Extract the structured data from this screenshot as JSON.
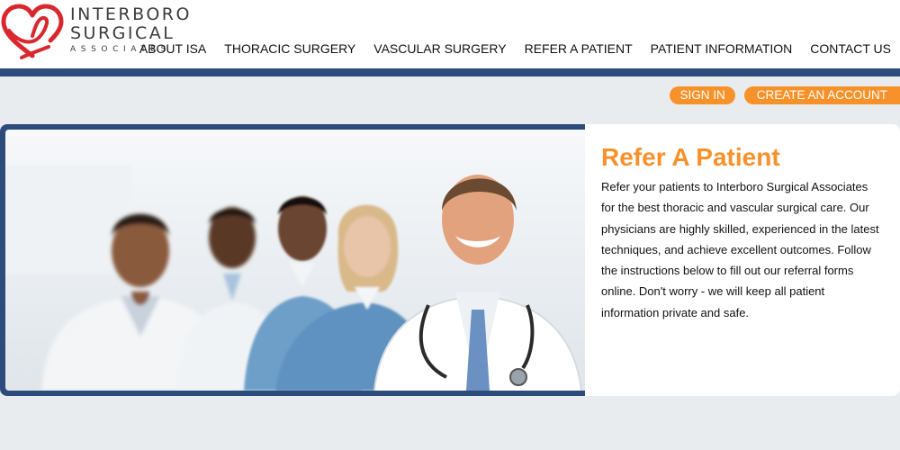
{
  "brand": {
    "line1": "INTERBORO",
    "line2": "SURGICAL",
    "line3": "ASSOCIATES",
    "heart_color": "#d9272e"
  },
  "nav": {
    "items": [
      {
        "label": "ABOUT ISA"
      },
      {
        "label": "THORACIC SURGERY"
      },
      {
        "label": "VASCULAR SURGERY"
      },
      {
        "label": "REFER A PATIENT"
      },
      {
        "label": "PATIENT INFORMATION"
      },
      {
        "label": "CONTACT US"
      }
    ]
  },
  "account": {
    "sign_in": "SIGN IN",
    "create_account": "CREATE AN ACCOUNT"
  },
  "hero": {
    "title": "Refer A Patient",
    "body": "Refer your patients to Interboro Surgical Associates for the best thoracic and vascular surgical care. Our physicians are highly skilled, experienced in the latest techniques, and achieve excellent outcomes. Follow the instructions below to fill out our referral forms online. Don't worry - we will keep all patient information private and safe."
  },
  "colors": {
    "accent_orange": "#f7922a",
    "navy_bar": "#2d4c7c",
    "page_bg": "#e9ecef"
  }
}
